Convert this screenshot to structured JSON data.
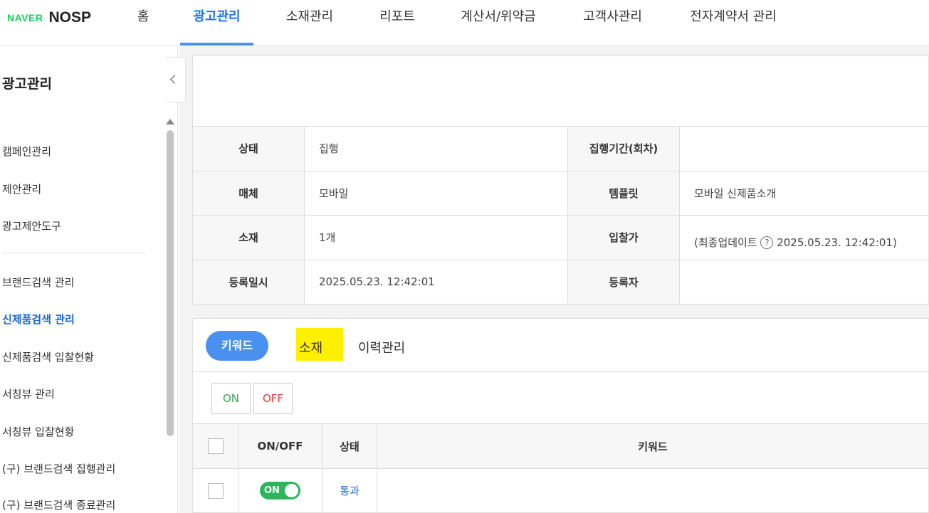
{
  "brand": {
    "naver": "NAVER",
    "nosp": "NOSP"
  },
  "topnav": {
    "items": [
      "홈",
      "광고관리",
      "소재관리",
      "리포트",
      "계산서/위약금",
      "고객사관리",
      "전자계약서 관리"
    ],
    "active_index": 1
  },
  "sidebar": {
    "title": "광고관리",
    "items": [
      "캠페인관리",
      "제안관리",
      "광고제안도구",
      "브랜드검색 관리",
      "신제품검색 관리",
      "신제품검색 입찰현황",
      "서칭뷰 관리",
      "서칭뷰 입찰현황",
      "(구) 브랜드검색 집행관리",
      "(구) 브랜드검색 종료관리"
    ],
    "active_item": "신제품검색 관리"
  },
  "info": {
    "rows": [
      {
        "l1": "상태",
        "v1": "집행",
        "l2": "집행기간(회차)",
        "v2": ""
      },
      {
        "l1": "매체",
        "v1": "모바일",
        "l2": "템플릿",
        "v2": "모바일 신제품소개"
      },
      {
        "l1": "소재",
        "v1": "1개",
        "l2": "입찰가",
        "v2": "(최종업데이트",
        "v2b": "2025.05.23. 12:42:01)"
      },
      {
        "l1": "등록일시",
        "v1": "2025.05.23. 12:42:01",
        "l2": "등록자",
        "v2": ""
      }
    ],
    "help_glyph": "?"
  },
  "tabs": {
    "keyword": "키워드",
    "creative": "소재",
    "history": "이력관리"
  },
  "actions": {
    "on": "ON",
    "off": "OFF"
  },
  "kwtable": {
    "headers": [
      "ON/OFF",
      "상태",
      "키워드"
    ],
    "row": {
      "toggle": "ON",
      "status": "통과"
    }
  },
  "colors": {
    "accent": "#4a90f0",
    "brand_green": "#19ce60",
    "toggle_on": "#2db55d",
    "highlight": "#ffef00"
  }
}
